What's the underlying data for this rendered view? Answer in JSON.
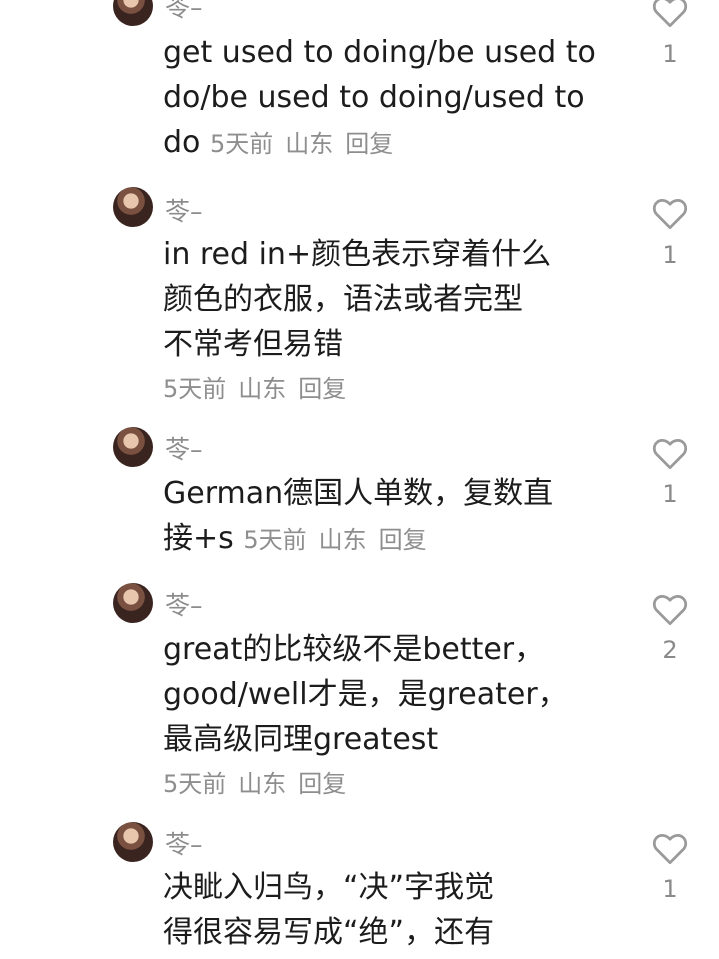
{
  "comments": [
    {
      "username": "苓–",
      "lines": [
        "get used to doing/be used to",
        "do/be used to doing/used to",
        "do"
      ],
      "time": "5天前",
      "location": "山东",
      "reply": "回复",
      "likes": "1"
    },
    {
      "username": "苓–",
      "lines": [
        "in red in+颜色表示穿着什么",
        "颜色的衣服，语法或者完型",
        "不常考但易错"
      ],
      "time": "5天前",
      "location": "山东",
      "reply": "回复",
      "likes": "1"
    },
    {
      "username": "苓–",
      "lines": [
        "German德国人单数，复数直",
        "接+s"
      ],
      "time": "5天前",
      "location": "山东",
      "reply": "回复",
      "likes": "1"
    },
    {
      "username": "苓–",
      "lines": [
        "great的比较级不是better，",
        "good/well才是，是greater，",
        "最高级同理greatest"
      ],
      "time": "5天前",
      "location": "山东",
      "reply": "回复",
      "likes": "2"
    },
    {
      "username": "苓–",
      "lines": [
        "决眦入归鸟，“决”字我觉",
        "得很容易写成“绝”，还有"
      ],
      "likes": "1"
    }
  ],
  "icons": {
    "like": "heart-outline-icon"
  },
  "colors": {
    "text": "#1c1c1c",
    "muted": "#8e8e8e",
    "icon": "#9a9a9a"
  }
}
